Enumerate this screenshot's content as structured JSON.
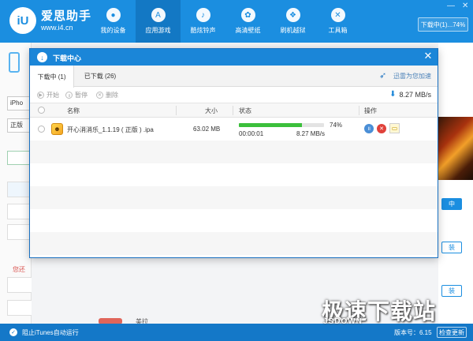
{
  "app": {
    "logo_mark": "iU",
    "name": "爱思助手",
    "url": "www.i4.cn",
    "brand_color": "#1b8ee0"
  },
  "nav": [
    {
      "label": "我的设备",
      "icon": "apple-icon",
      "glyph": ""
    },
    {
      "label": "应用游戏",
      "icon": "app-store-icon",
      "glyph": "A"
    },
    {
      "label": "酷炫铃声",
      "icon": "bell-icon",
      "glyph": "♪"
    },
    {
      "label": "高清壁纸",
      "icon": "flower-icon",
      "glyph": "✿"
    },
    {
      "label": "刷机越狱",
      "icon": "box-icon",
      "glyph": "❖"
    },
    {
      "label": "工具箱",
      "icon": "tools-icon",
      "glyph": "✕"
    }
  ],
  "window_controls": {
    "minimize": "—",
    "close": "✕"
  },
  "download_status_button": "下载中(1)...74%",
  "left_panel": {
    "device_chip": "iPho",
    "edition_chip": "正版",
    "red_text": "您还"
  },
  "background": {
    "button_downloading": "中",
    "button_a": "装",
    "button_b": "装",
    "bottom_text": "美拉"
  },
  "dialog": {
    "title": "下载中心",
    "close_label": "✕",
    "tabs": [
      {
        "label": "下载中 (1)"
      },
      {
        "label": "已下载 (26)"
      }
    ],
    "accelerator_label": "迅雷为您加速",
    "toolbar": {
      "start": "开始",
      "pause": "暂停",
      "delete": "删除",
      "speed": "8.27 MB/s"
    },
    "columns": {
      "name": "名称",
      "size": "大小",
      "status": "状态",
      "action": "操作"
    },
    "rows": [
      {
        "name": "开心消消乐_1.1.19 ( 正版 ) .ipa",
        "size": "63.02 MB",
        "percent": "74%",
        "progress": 0.74,
        "elapsed": "00:00:01",
        "speed": "8.27 MB/s"
      }
    ]
  },
  "statusbar": {
    "check_label": "阻止iTunes自动运行",
    "version": "版本号：6.15",
    "update_button": "检查更新"
  },
  "watermark": {
    "title": "极速下载站",
    "url": "JSDOWN"
  }
}
